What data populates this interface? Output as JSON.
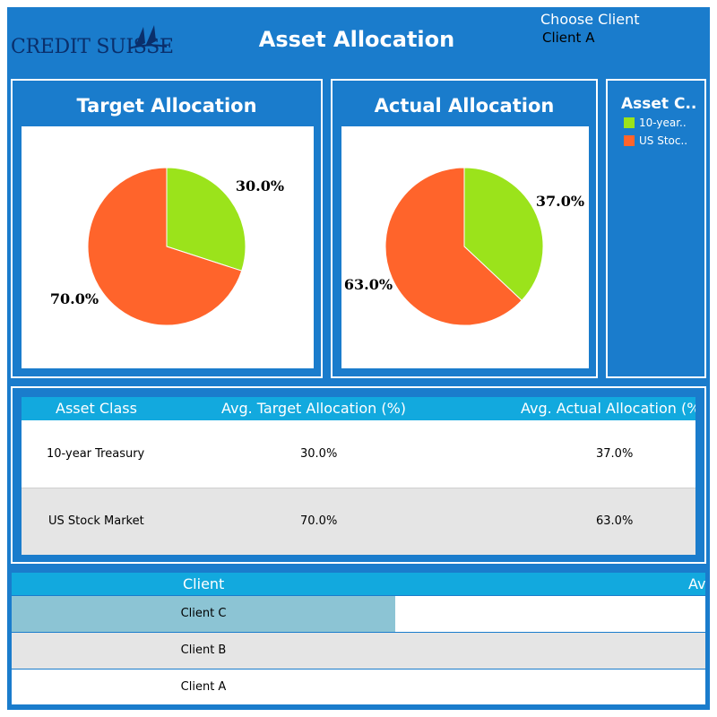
{
  "header": {
    "logo_text": "CREDIT SUISSE",
    "title": "Asset Allocation",
    "chooser_label": "Choose Client",
    "chooser_value": "Client A"
  },
  "colors": {
    "frame": "#1a7ccc",
    "header_strip": "#12a9de",
    "treasury": "#9be31b",
    "stock": "#ff642b",
    "selected_row": "#8cc4d4",
    "alt_row": "#e5e5e5"
  },
  "target_panel": {
    "title": "Target Allocation"
  },
  "actual_panel": {
    "title": "Actual Allocation"
  },
  "legend": {
    "title": "Asset C..",
    "items": [
      {
        "label": "10-year..",
        "color": "#9be31b"
      },
      {
        "label": "US Stoc..",
        "color": "#ff642b"
      }
    ]
  },
  "chart_data": [
    {
      "type": "pie",
      "title": "Target Allocation",
      "labels": [
        "10-year Treasury",
        "US Stock Market"
      ],
      "values": [
        30.0,
        70.0
      ],
      "slice_labels": [
        "30.0%",
        "70.0%"
      ],
      "colors": [
        "#9be31b",
        "#ff642b"
      ]
    },
    {
      "type": "pie",
      "title": "Actual Allocation",
      "labels": [
        "10-year Treasury",
        "US Stock Market"
      ],
      "values": [
        37.0,
        63.0
      ],
      "slice_labels": [
        "37.0%",
        "63.0%"
      ],
      "colors": [
        "#9be31b",
        "#ff642b"
      ]
    }
  ],
  "summary_table": {
    "columns": [
      "Asset Class",
      "Avg. Target Allocation  (%)",
      "Avg. Actual Allocation  (%)"
    ],
    "rows": [
      [
        "10-year Treasury",
        "30.0%",
        "37.0%"
      ],
      [
        "US Stock Market",
        "70.0%",
        "63.0%"
      ]
    ]
  },
  "client_table": {
    "columns": [
      "Client",
      "Av"
    ],
    "rows": [
      "Client C",
      "Client B",
      "Client A"
    ]
  }
}
